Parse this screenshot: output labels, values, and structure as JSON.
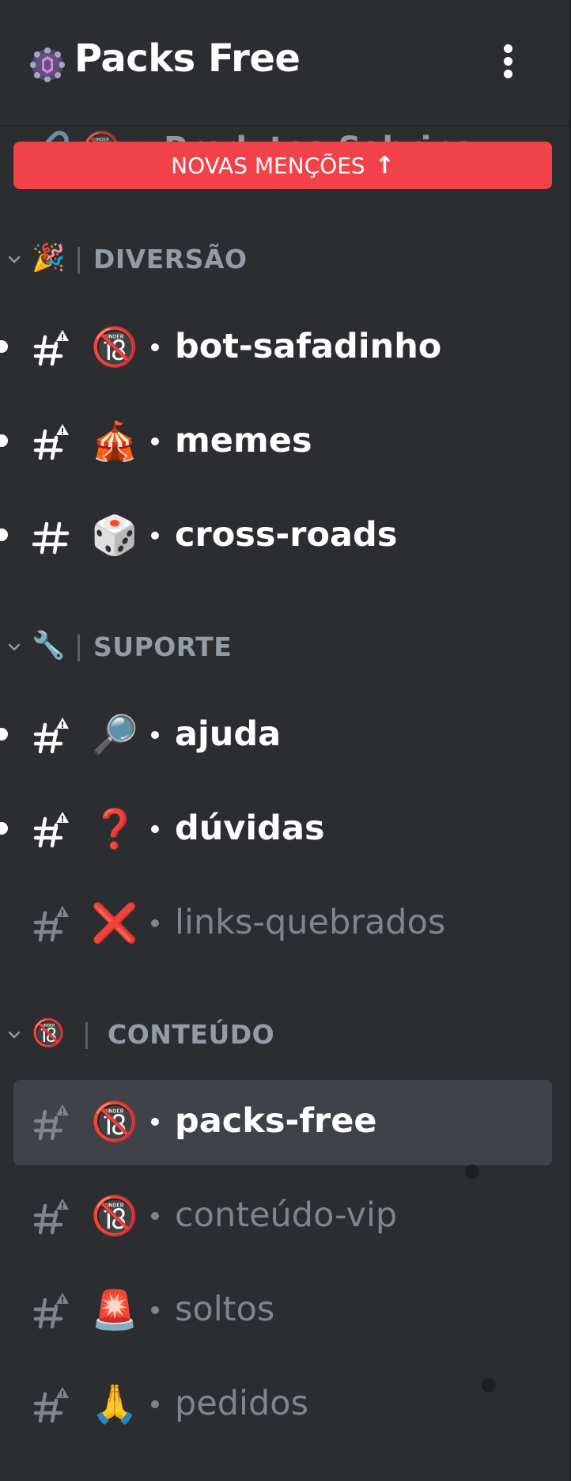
{
  "header": {
    "server_name": "Packs Free"
  },
  "banner": {
    "label": "NOVAS MENÇÕES",
    "arrow": "↑"
  },
  "ghost_channel": {
    "text": "🔗 🔞 • Produtos-Sabrina"
  },
  "categories": [
    {
      "emoji": "🎉",
      "name": "DIVERSÃO"
    },
    {
      "emoji": "🔧",
      "name": "SUPORTE"
    },
    {
      "emoji": "🔞",
      "name": "CONTEÚDO"
    }
  ],
  "channels": [
    {
      "emoji": "🔞",
      "name": "bot-safadinho",
      "state": "unread",
      "locked": true
    },
    {
      "emoji": "🎪",
      "name": "memes",
      "state": "unread",
      "locked": true
    },
    {
      "emoji": "🎲",
      "name": "cross-roads",
      "state": "unread",
      "locked": false
    },
    {
      "emoji": "🔎",
      "name": "ajuda",
      "state": "unread",
      "locked": true
    },
    {
      "emoji": "❓",
      "name": "dúvidas",
      "state": "unread",
      "locked": true
    },
    {
      "emoji": "❌",
      "name": "links-quebrados",
      "state": "muted",
      "locked": true
    },
    {
      "emoji": "🔞",
      "name": "packs-free",
      "state": "selected",
      "locked": true
    },
    {
      "emoji": "🔞",
      "name": "conteúdo-vip",
      "state": "muted",
      "locked": true
    },
    {
      "emoji": "🚨",
      "name": "soltos",
      "state": "muted",
      "locked": true
    },
    {
      "emoji": "🙏",
      "name": "pedidos",
      "state": "muted",
      "locked": true
    }
  ],
  "colors": {
    "background": "#2b2d31",
    "selected_bg": "#404249",
    "banner": "#f04248",
    "unread_text": "#ffffff",
    "muted_text": "#80848e",
    "category_text": "#949ba4"
  },
  "icons": {
    "server": "server-badge-icon",
    "menu": "kebab-menu-icon",
    "category_toggle": "chevron-down-icon",
    "channel": "text-channel-hash-icon",
    "channel_locked": "text-channel-nsfw-icon"
  }
}
